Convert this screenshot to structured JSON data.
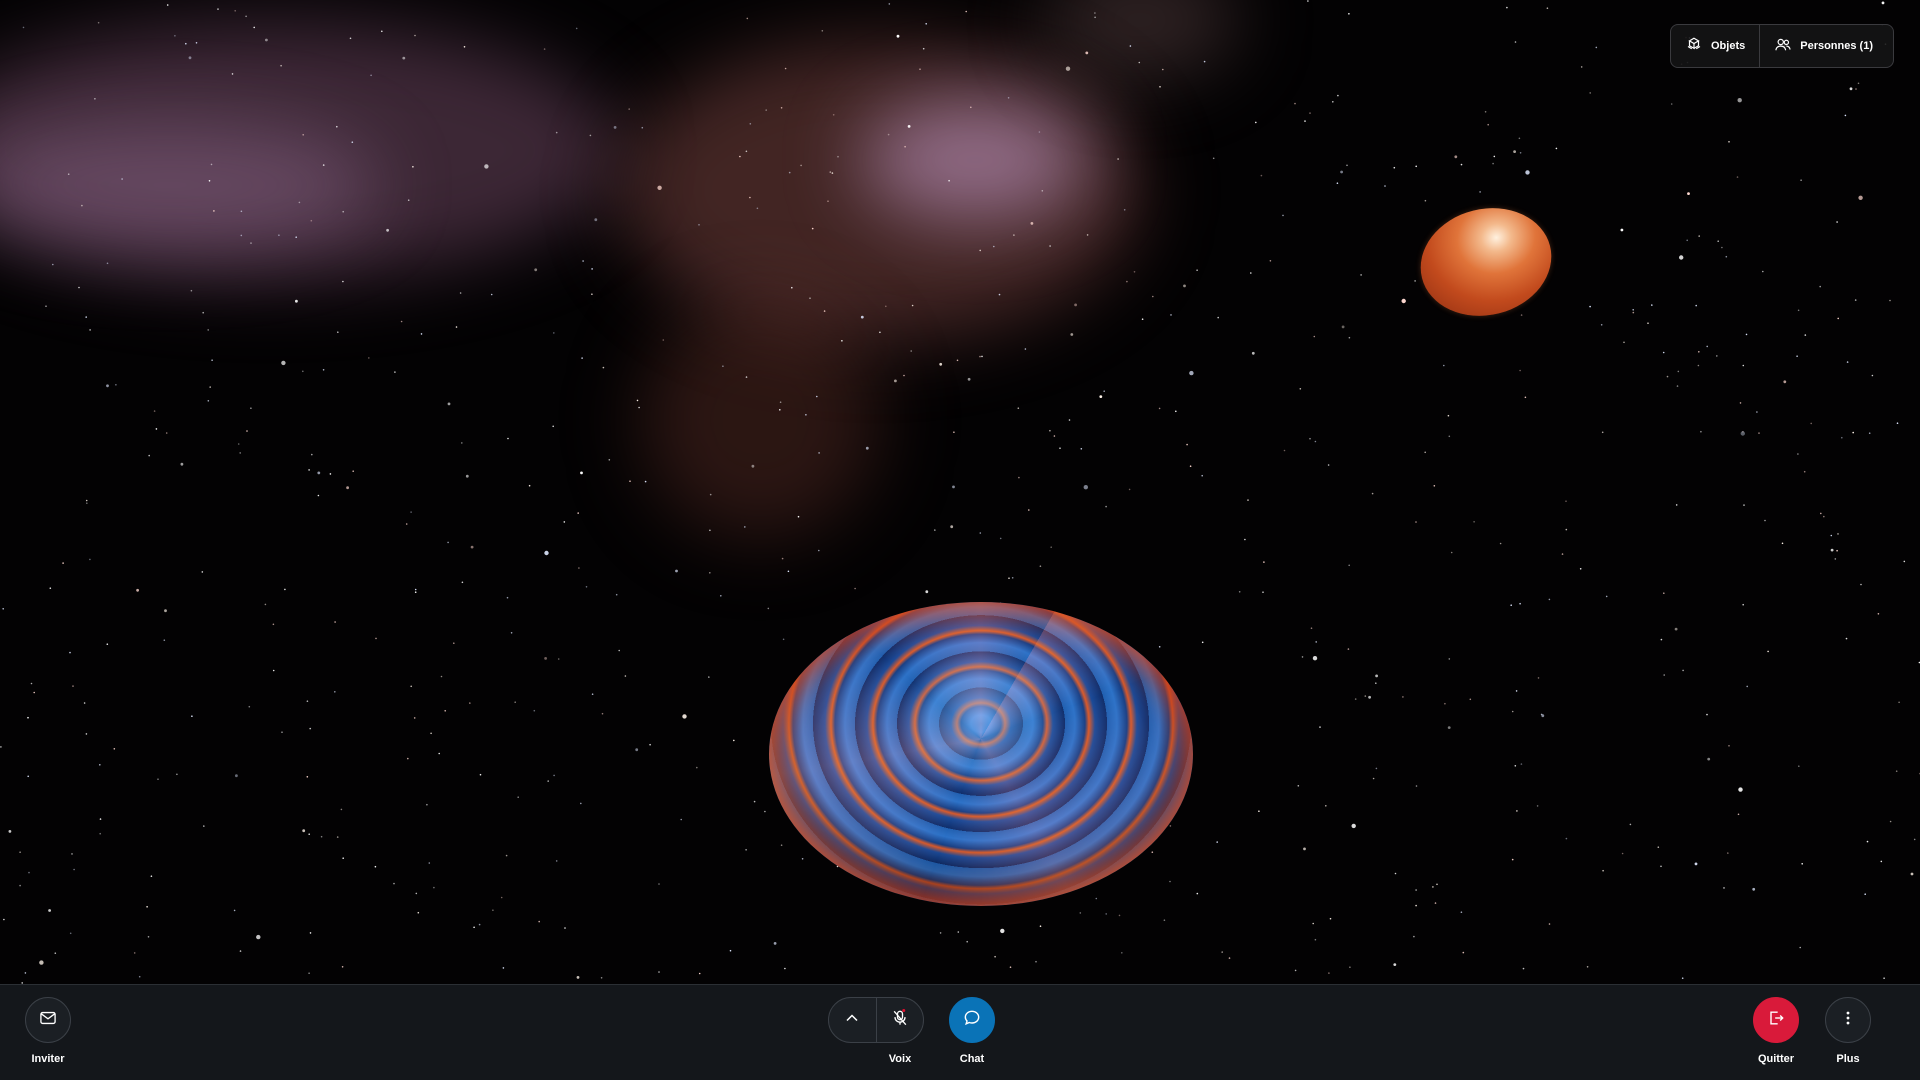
{
  "top_panel": {
    "objects_label": "Objets",
    "people_label": "Personnes (1)"
  },
  "toolbar": {
    "invite_label": "Inviter",
    "voice_label": "Voix",
    "chat_label": "Chat",
    "quit_label": "Quitter",
    "more_label": "Plus"
  },
  "icons": {
    "objects": "objects-icon",
    "people": "people-icon",
    "invite": "mail-icon",
    "expand": "chevron-up-icon",
    "mic": "mic-muted-icon",
    "chat": "chat-bubble-icon",
    "quit": "exit-icon",
    "more": "more-vertical-icon"
  },
  "colors": {
    "chat_accent": "#0a73b7",
    "quit_accent": "#d91a3a",
    "mic_indicator": "#e0102f"
  }
}
